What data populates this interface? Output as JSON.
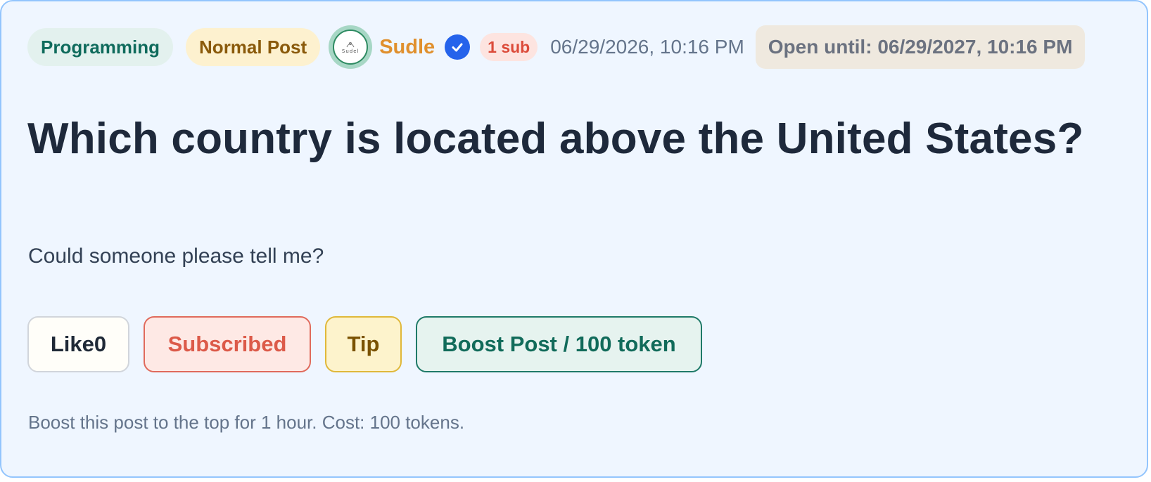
{
  "post": {
    "category": "Programming",
    "post_type": "Normal Post",
    "author": {
      "avatar_text": "Sudel",
      "username": "Sudle",
      "verified_icon": "check-circle-icon",
      "sub_count": "1 sub"
    },
    "timestamp": "06/29/2026, 10:16 PM",
    "open_until": "Open until: 06/29/2027, 10:16 PM",
    "title": "Which country is located above the United States?",
    "body": "Could someone please tell me?"
  },
  "actions": {
    "like_label": "Like0",
    "subscribed_label": "Subscribed",
    "tip_label": "Tip",
    "boost_label": "Boost Post / 100 token"
  },
  "boost_hint": "Boost this post to the top for 1 hour. Cost: 100 tokens.",
  "colors": {
    "card_bg": "#eff6ff",
    "card_border": "#93c5fd",
    "category": "#0f6b5c",
    "username": "#e0902e",
    "verified": "#2563eb",
    "subscribed": "#dc5a49",
    "boost": "#116b5a"
  }
}
